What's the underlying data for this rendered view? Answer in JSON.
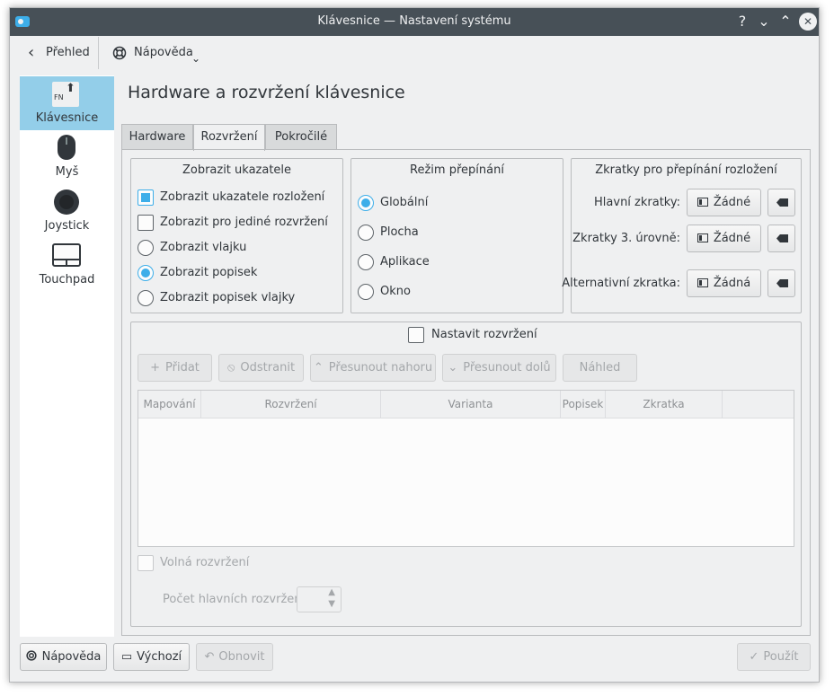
{
  "window": {
    "title": "Klávesnice  — Nastavení systému",
    "help_glyph": "?",
    "minimize_glyph": "⌄",
    "maximize_glyph": "⌃",
    "close_glyph": "✕"
  },
  "toolbar": {
    "overview_label": "Přehled",
    "help_label": "Nápověda"
  },
  "sidebar": {
    "items": [
      {
        "label": "Klávesnice",
        "icon": "keyboard-icon",
        "badge": "FN"
      },
      {
        "label": "Myš",
        "icon": "mouse-icon"
      },
      {
        "label": "Joystick",
        "icon": "joystick-icon"
      },
      {
        "label": "Touchpad",
        "icon": "touchpad-icon"
      }
    ]
  },
  "page": {
    "title": "Hardware a rozvržení klávesnice"
  },
  "tabs": [
    "Hardware",
    "Rozvržení",
    "Pokročilé"
  ],
  "indicator_group": {
    "title": "Zobrazit ukazatele",
    "options": [
      "Zobrazit ukazatele rozložení",
      "Zobrazit pro jediné rozvržení",
      "Zobrazit vlajku",
      "Zobrazit popisek",
      "Zobrazit popisek vlajky"
    ]
  },
  "switch_mode_group": {
    "title": "Režim přepínání",
    "options": [
      "Globální",
      "Plocha",
      "Aplikace",
      "Okno"
    ]
  },
  "shortcuts_group": {
    "title": "Zkratky pro přepínání rozložení",
    "rows": [
      {
        "label": "Hlavní zkratky:",
        "value": "Žádné"
      },
      {
        "label": "Zkratky 3. úrovně:",
        "value": "Žádné"
      },
      {
        "label": "Alternativní zkratka:",
        "value": "Žádná"
      }
    ]
  },
  "layouts": {
    "configure_label": "Nastavit rozvržení",
    "buttons": {
      "add": "Přidat",
      "remove": "Odstranit",
      "move_up": "Přesunout nahoru",
      "move_down": "Přesunout dolů",
      "preview": "Náhled"
    },
    "columns": [
      "Mapování",
      "Rozvržení",
      "Varianta",
      "Popisek",
      "Zkratka"
    ],
    "spare_layouts_label": "Volná rozvržení",
    "main_count_label": "Počet hlavních rozvržení:"
  },
  "footer": {
    "help": "Nápověda",
    "defaults": "Výchozí",
    "reset": "Obnovit",
    "apply": "Použít"
  },
  "colors": {
    "accent": "#3daee9",
    "titlebar": "#475057",
    "selection": "#93cee9"
  }
}
